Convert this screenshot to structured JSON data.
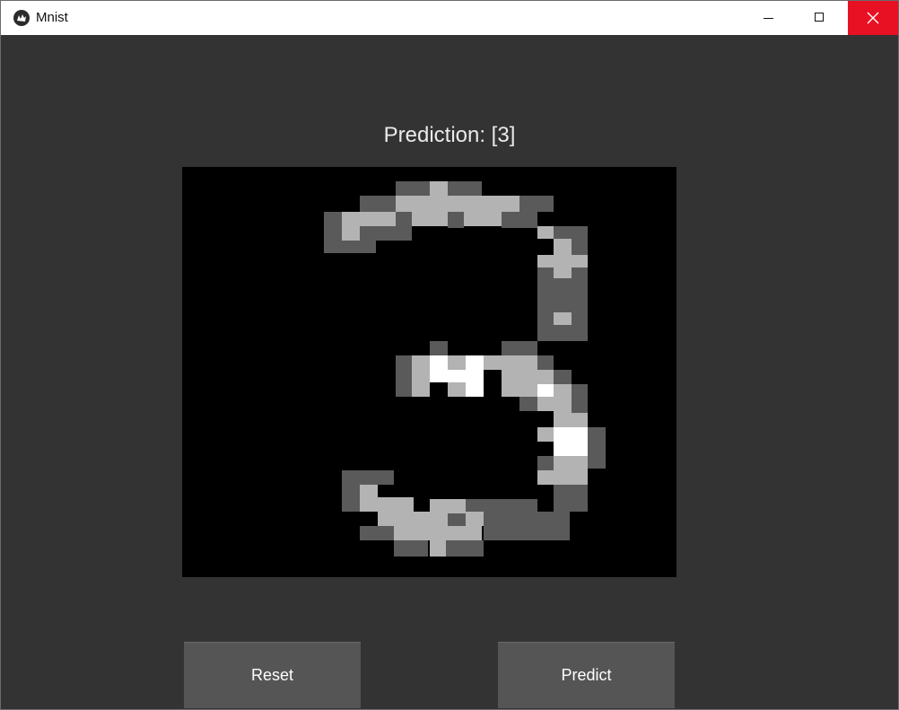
{
  "window": {
    "title": "Mnist"
  },
  "main": {
    "prediction_text": "Prediction: [3]"
  },
  "buttons": {
    "reset_label": "Reset",
    "predict_label": "Predict"
  },
  "digit_drawing": {
    "colors": {
      "dark": "#5a5a5a",
      "light": "#b3b3b3",
      "white": "#ffffff"
    },
    "rows": [
      "............................",
      "............................",
      "............................",
      "............................",
      "............................",
      "............................",
      "............................",
      "............................",
      "..........................."
    ]
  }
}
